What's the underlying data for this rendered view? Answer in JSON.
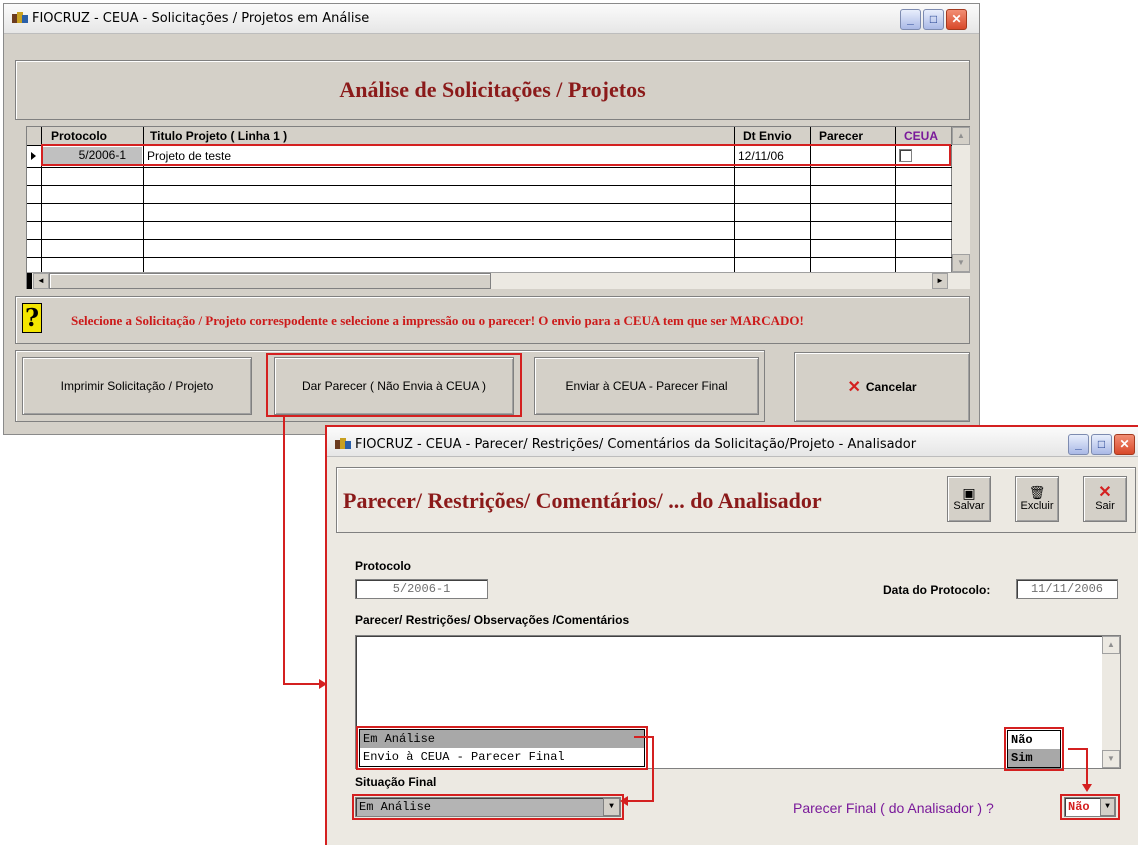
{
  "main_window": {
    "title": "FIOCRUZ - CEUA - Solicitações / Projetos em Análise",
    "heading": "Análise de Solicitações / Projetos",
    "grid": {
      "columns": [
        "Protocolo",
        "Titulo Projeto ( Linha 1 )",
        "Dt Envio",
        "Parecer",
        "CEUA"
      ],
      "rows": [
        {
          "protocolo": "5/2006-1",
          "titulo": "Projeto de teste",
          "dt_envio": "12/11/06",
          "parecer": "",
          "ceua_checked": false
        }
      ]
    },
    "hint": "Selecione a Solicitação / Projeto correspodente e selecione a impressão ou o parecer! O envio para a CEUA tem que ser MARCADO!",
    "buttons": {
      "print": "Imprimir Solicitação / Projeto",
      "give_opinion": "Dar Parecer  ( Não Envia à CEUA )",
      "send_ceua": "Enviar à CEUA - Parecer Final",
      "cancel": "Cancelar"
    }
  },
  "dialog": {
    "title": "FIOCRUZ - CEUA - Parecer/ Restrições/ Comentários da Solicitação/Projeto - Analisador",
    "heading": "Parecer/ Restrições/ Comentários/ ... do Analisador",
    "toolbar": {
      "save": "Salvar",
      "delete": "Excluir",
      "exit": "Sair"
    },
    "protocolo_label": "Protocolo",
    "protocolo_value": "5/2006-1",
    "data_label": "Data do Protocolo:",
    "data_value": "11/11/2006",
    "comments_label": "Parecer/ Restrições/ Observações /Comentários",
    "situacao_label": "Situação Final",
    "situacao_value": "Em Análise",
    "situacao_options": [
      "Em Análise",
      "Envio à CEUA - Parecer Final"
    ],
    "parecer_final_label": "Parecer Final ( do Analisador ) ?",
    "parecer_final_value": "Não",
    "parecer_final_options": [
      "Não",
      "Sim"
    ]
  },
  "colors": {
    "accent_red": "#d42020",
    "heading_red": "#8b1a1a",
    "purple": "#7a1a9a"
  }
}
